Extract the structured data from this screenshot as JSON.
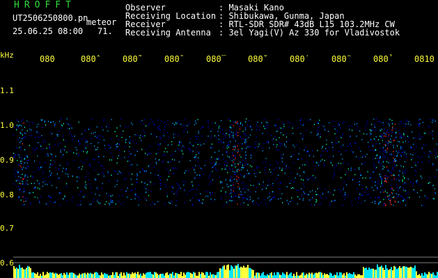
{
  "station": {
    "brand": "HROFFT",
    "filename": "UT2506250800.pn",
    "meteor_type": "meteor",
    "datetime": "25.06.25 08:00",
    "meteor_count": "71."
  },
  "header": {
    "rows": [
      {
        "key": "Observer",
        "value": ": Masaki Kano"
      },
      {
        "key": "Receiving Location",
        "value": ": Shibukawa, Gunma, Japan"
      },
      {
        "key": "Receiver",
        "value": ": RTL-SDR SDR# 43dB L15 103.2MHz CW"
      },
      {
        "key": "Receiving Antenna",
        "value": ": 3el Yagi(V) Az 330 for Vladivostok"
      }
    ]
  },
  "axis": {
    "unit": "kHz",
    "y_ticks": [
      "1.1",
      "1.0",
      "0.9",
      "0.8",
      "0.7",
      "0.6"
    ],
    "x_ticks": [
      "080",
      "080̂",
      "080̃",
      "080̄",
      "080̅",
      "080̆",
      "080̇",
      "080̈",
      "080̉",
      "0810"
    ]
  },
  "colors": {
    "brand": "#2fdc3a",
    "labels": "#ffffff",
    "axis": "#ffff3c",
    "noise_low": "#0000c8",
    "noise_mid": "#00a0ff",
    "noise_high": "#00ffb0",
    "hot": "#ff2a2a",
    "level_cyan": "#00e6ff",
    "level_yellow": "#ffff3c"
  },
  "chart_data": {
    "type": "heatmap",
    "xlabel": "",
    "ylabel": "kHz",
    "ylim": [
      0.58,
      1.14
    ],
    "x_ticks": [
      "080",
      "080̂",
      "080̃",
      "080̄",
      "080̅",
      "080̆",
      "080̇",
      "080̈",
      "080̉",
      "0810"
    ],
    "y_ticks": [
      1.1,
      1.0,
      0.9,
      0.8,
      0.7,
      0.6
    ],
    "signal_band_khz": [
      0.77,
      1.02
    ],
    "activity_bursts": [
      {
        "label": "080",
        "intensity": 0.9
      },
      {
        "label": "080̅",
        "intensity": 1.0
      },
      {
        "label": "080̉",
        "intensity": 0.85
      }
    ]
  }
}
